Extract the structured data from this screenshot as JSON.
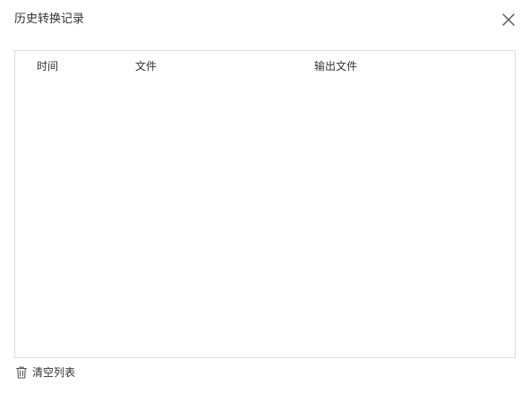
{
  "dialog": {
    "title": "历史转换记录"
  },
  "table": {
    "columns": [
      "时间",
      "文件",
      "输出文件"
    ],
    "rows": []
  },
  "footer": {
    "clear_label": "清空列表"
  },
  "icons": {
    "close": "close-icon",
    "clear": "trash-icon"
  }
}
